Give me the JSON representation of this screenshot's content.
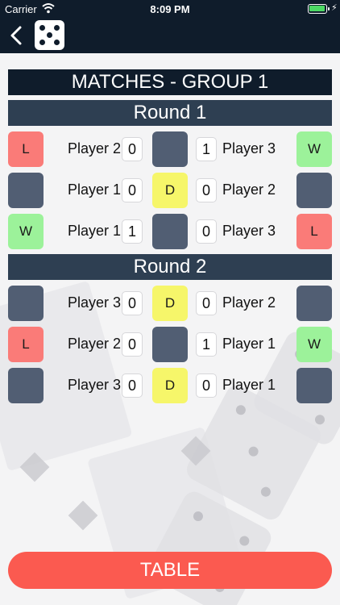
{
  "status_bar": {
    "carrier": "Carrier",
    "time": "8:09 PM"
  },
  "nav": {
    "back_icon": "chevron-left-icon",
    "logo_icon": "dice-five-icon"
  },
  "title": "MATCHES - GROUP 1",
  "rounds": [
    {
      "label": "Round 1",
      "matches": [
        {
          "left_result": "L",
          "left_player": "Player 2",
          "left_score": "0",
          "mid_result": "",
          "right_score": "1",
          "right_player": "Player 3",
          "right_result": "W"
        },
        {
          "left_result": "",
          "left_player": "Player 1",
          "left_score": "0",
          "mid_result": "D",
          "right_score": "0",
          "right_player": "Player 2",
          "right_result": ""
        },
        {
          "left_result": "W",
          "left_player": "Player 1",
          "left_score": "1",
          "mid_result": "",
          "right_score": "0",
          "right_player": "Player 3",
          "right_result": "L"
        }
      ]
    },
    {
      "label": "Round 2",
      "matches": [
        {
          "left_result": "",
          "left_player": "Player 3",
          "left_score": "0",
          "mid_result": "D",
          "right_score": "0",
          "right_player": "Player 2",
          "right_result": ""
        },
        {
          "left_result": "L",
          "left_player": "Player 2",
          "left_score": "0",
          "mid_result": "",
          "right_score": "1",
          "right_player": "Player 1",
          "right_result": "W"
        },
        {
          "left_result": "",
          "left_player": "Player 3",
          "left_score": "0",
          "mid_result": "D",
          "right_score": "0",
          "right_player": "Player 1",
          "right_result": ""
        }
      ]
    }
  ],
  "table_button": "TABLE",
  "colors": {
    "win": "#9cf29a",
    "loss": "#fa7b78",
    "draw": "#f6f66a",
    "none": "#515e73",
    "header": "#0f1c2b",
    "round_bar": "#2e3f52",
    "table_button": "#fb5a50"
  }
}
